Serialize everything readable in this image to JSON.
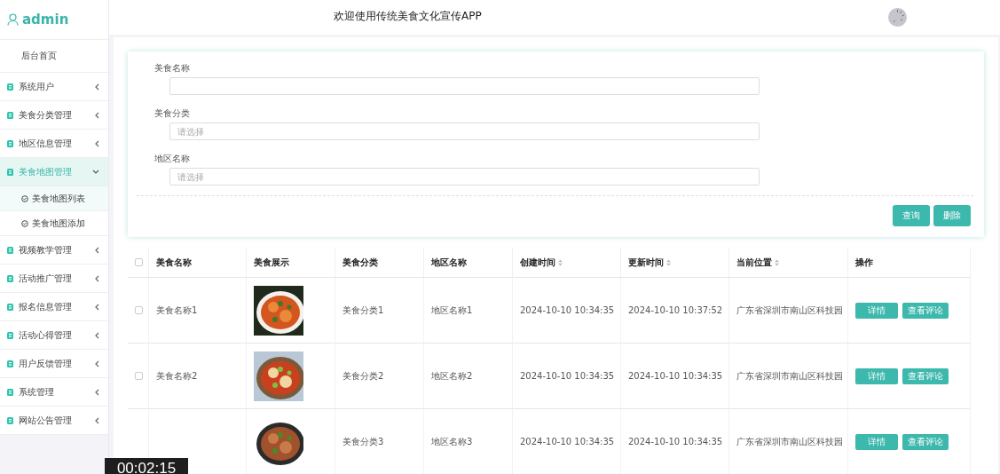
{
  "brand": {
    "title": "admin"
  },
  "header": {
    "title": "欢迎使用传统美食文化宣传APP"
  },
  "sidebar": {
    "items": [
      {
        "label": "后台首页",
        "kind": "home",
        "selected": false
      },
      {
        "label": "系统用户",
        "kind": "menu",
        "selected": false,
        "expanded": false
      },
      {
        "label": "美食分类管理",
        "kind": "menu",
        "selected": false,
        "expanded": false
      },
      {
        "label": "地区信息管理",
        "kind": "menu",
        "selected": false,
        "expanded": false
      },
      {
        "label": "美食地图管理",
        "kind": "menu",
        "selected": true,
        "expanded": true,
        "children": [
          {
            "label": "美食地图列表",
            "selected": true
          },
          {
            "label": "美食地图添加",
            "selected": false
          }
        ]
      },
      {
        "label": "视频教学管理",
        "kind": "menu",
        "selected": false,
        "expanded": false
      },
      {
        "label": "活动推广管理",
        "kind": "menu",
        "selected": false,
        "expanded": false
      },
      {
        "label": "报名信息管理",
        "kind": "menu",
        "selected": false,
        "expanded": false
      },
      {
        "label": "活动心得管理",
        "kind": "menu",
        "selected": false,
        "expanded": false
      },
      {
        "label": "用户反馈管理",
        "kind": "menu",
        "selected": false,
        "expanded": false
      },
      {
        "label": "系统管理",
        "kind": "menu",
        "selected": false,
        "expanded": false
      },
      {
        "label": "网站公告管理",
        "kind": "menu",
        "selected": false,
        "expanded": false
      }
    ]
  },
  "search": {
    "fields": [
      {
        "label": "美食名称"
      },
      {
        "label": "美食分类",
        "placeholder": "请选择"
      },
      {
        "label": "地区名称",
        "placeholder": "请选择"
      }
    ],
    "buttons": [
      "查询",
      "删除"
    ]
  },
  "table": {
    "header_checked": false,
    "columns": [
      {
        "label": "美食名称",
        "sortable": false
      },
      {
        "label": "美食展示",
        "sortable": false
      },
      {
        "label": "美食分类",
        "sortable": false
      },
      {
        "label": "地区名称",
        "sortable": false
      },
      {
        "label": "创建时间",
        "sortable": true
      },
      {
        "label": "更新时间",
        "sortable": true
      },
      {
        "label": "当前位置",
        "sortable": true
      },
      {
        "label": "操作",
        "sortable": false
      }
    ],
    "rows": [
      {
        "checked": false,
        "name": "美食名称1",
        "image": {
          "kind": "picture"
        },
        "category": "美食分类1",
        "region": "地区名称1",
        "created": "2024-10-10 10:34:35",
        "updated": "2024-10-10 10:37:52",
        "location": "广东省深圳市南山区科技园",
        "actions": [
          "详情",
          "查看评论"
        ]
      },
      {
        "checked": false,
        "name": "美食名称2",
        "image": {
          "kind": "picture"
        },
        "category": "美食分类2",
        "region": "地区名称2",
        "created": "2024-10-10 10:34:35",
        "updated": "2024-10-10 10:34:35",
        "location": "广东省深圳市南山区科技园",
        "actions": [
          "详情",
          "查看评论"
        ]
      },
      {
        "image": {
          "kind": "picture"
        },
        "category": "美食分类3",
        "region": "地区名称3",
        "created": "2024-10-10 10:34:35",
        "updated": "2024-10-10 10:34:35",
        "location": "广东省深圳市南山区科技园",
        "actions": [
          "详情",
          "查看评论"
        ]
      }
    ]
  },
  "recording_timer": "00:02:15"
}
